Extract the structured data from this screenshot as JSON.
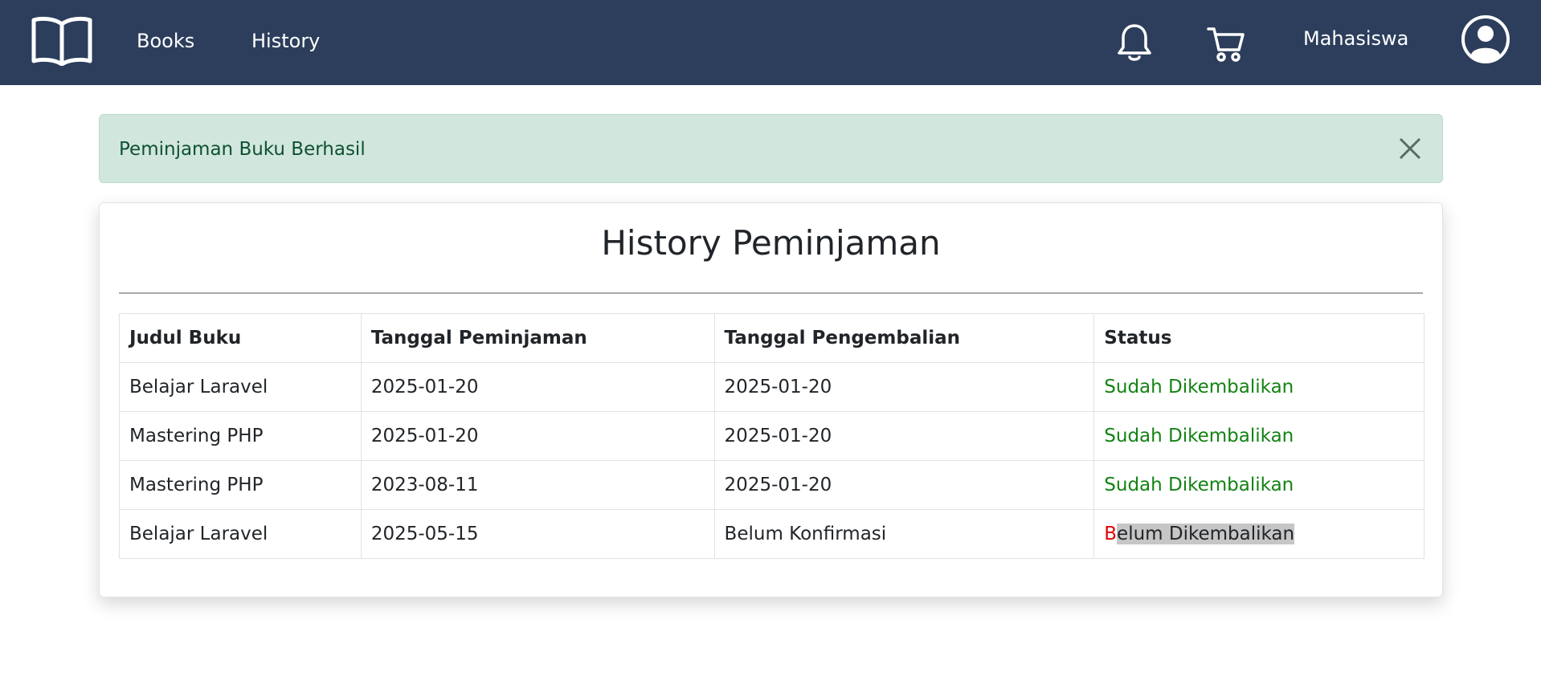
{
  "navbar": {
    "links": [
      "Books",
      "History"
    ],
    "username": "Mahasiswa",
    "icons": [
      "book-open-icon",
      "bell-icon",
      "cart-icon",
      "user-circle-icon"
    ]
  },
  "alert": {
    "message": "Peminjaman Buku Berhasil",
    "close_icon": "close-icon"
  },
  "page": {
    "title": "History Peminjaman"
  },
  "table": {
    "headers": [
      "Judul Buku",
      "Tanggal Peminjaman",
      "Tanggal Pengembalian",
      "Status"
    ],
    "rows": [
      [
        "Belajar Laravel",
        "2025-01-20",
        "2025-01-20",
        "Sudah Dikembalikan"
      ],
      [
        "Mastering PHP",
        "2025-01-20",
        "2025-01-20",
        "Sudah Dikembalikan"
      ],
      [
        "Mastering PHP",
        "2023-08-11",
        "2025-01-20",
        "Sudah Dikembalikan"
      ],
      [
        "Belajar Laravel",
        "2025-05-15",
        "Belum Konfirmasi",
        "Belum Dikembalikan"
      ]
    ]
  },
  "colors": {
    "navbar": "#2c3e5c",
    "alert_bg": "#d1e7dd",
    "alert_text": "#0f5132",
    "status_returned": "#138313",
    "status_not_returned_marker": "#e00000"
  }
}
